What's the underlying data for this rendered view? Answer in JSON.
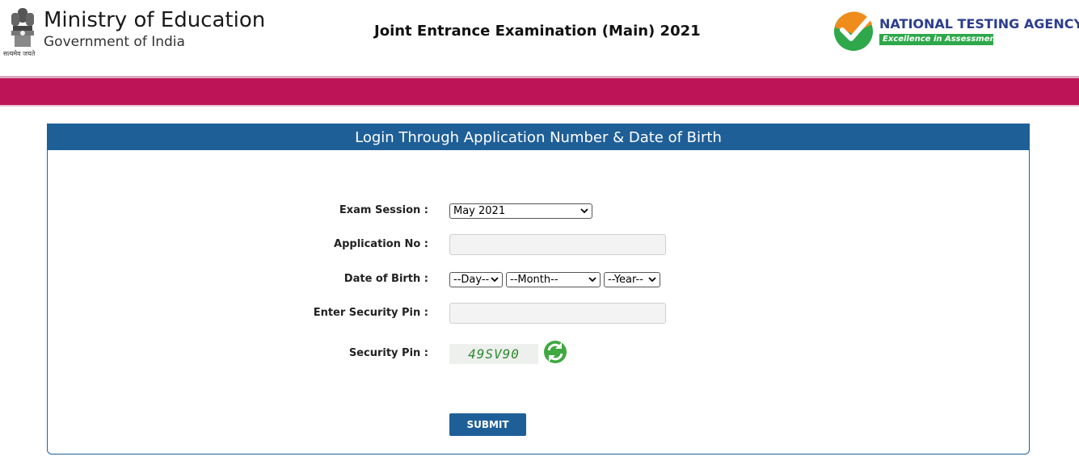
{
  "header": {
    "emblem_caption": "सत्यमेव जयते",
    "ministry_title": "Ministry of Education",
    "ministry_subtitle": "Government of India",
    "exam_title": "Joint Entrance Examination (Main) 2021",
    "agency_name": "NATIONAL TESTING AGENCY",
    "agency_tagline": "Excellence in Assessment"
  },
  "colors": {
    "band": "#bd1457",
    "panel_header": "#1f5f98",
    "nta_blue": "#2c3e8f",
    "nta_green": "#2ea84a",
    "nta_orange": "#f08c1c"
  },
  "form": {
    "heading": "Login Through Application Number & Date of Birth",
    "exam_session_label": "Exam Session :",
    "exam_session_value": "May 2021",
    "application_no_label": "Application No :",
    "application_no_value": "",
    "dob_label": "Date of Birth :",
    "dob_day": "--Day--",
    "dob_month": "--Month--",
    "dob_year": "--Year--",
    "security_pin_input_label": "Enter Security Pin :",
    "security_pin_input_value": "",
    "security_pin_label": "Security Pin :",
    "captcha_text": "49SV90",
    "submit_label": "SUBMIT"
  },
  "icons": [
    "emblem-icon",
    "nta-logo-icon",
    "chevron-down-icon",
    "refresh-icon"
  ]
}
